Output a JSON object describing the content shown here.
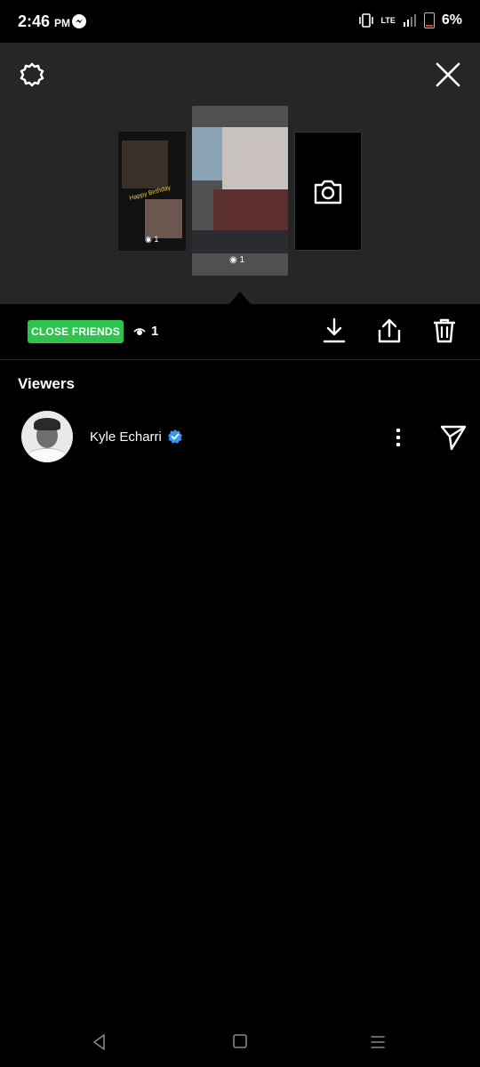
{
  "status_bar": {
    "time": "2:46",
    "ampm": "PM",
    "network": "LTE",
    "battery": "6%"
  },
  "story_tray": {
    "selected_index": 1,
    "left_thumb_views": "1",
    "left_thumb_caption": "Happy Birthday",
    "center_thumb_views": "1"
  },
  "actions": {
    "close_friends_label": "CLOSE FRIENDS",
    "view_count": "1"
  },
  "viewers": {
    "title": "Viewers",
    "list": [
      {
        "name": "Kyle Echarri",
        "verified": true
      }
    ]
  },
  "colors": {
    "close_friends_green": "#2ec24e",
    "verified_blue": "#3897f0",
    "panel_gray": "#262626"
  }
}
